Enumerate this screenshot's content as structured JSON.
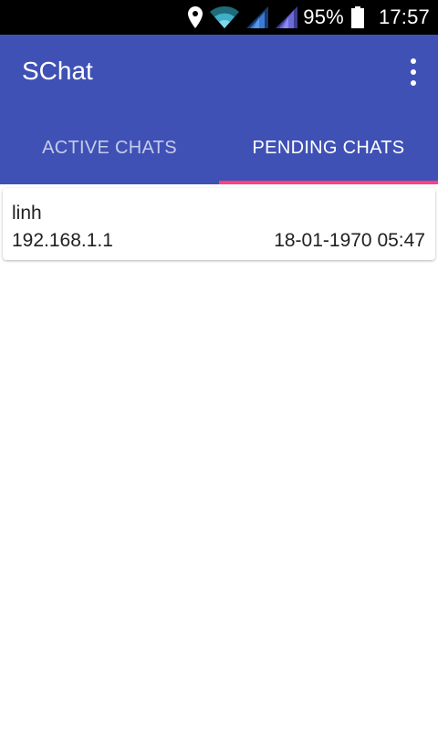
{
  "status_bar": {
    "battery": "95%",
    "time": "17:57",
    "icons": [
      "location-icon",
      "wifi-icon",
      "signal-sim1-icon",
      "signal-sim2-icon",
      "battery-icon"
    ]
  },
  "app_bar": {
    "title": "SChat",
    "menu_icon": "overflow-menu-icon",
    "color": "#3f51b5"
  },
  "tabs": [
    {
      "label": "ACTIVE CHATS",
      "selected": false
    },
    {
      "label": "PENDING CHATS",
      "selected": true
    }
  ],
  "tab_indicator_color": "#ff4081",
  "chats": [
    {
      "name": "linh",
      "ip": "192.168.1.1",
      "timestamp": "18-01-1970 05:47"
    }
  ]
}
